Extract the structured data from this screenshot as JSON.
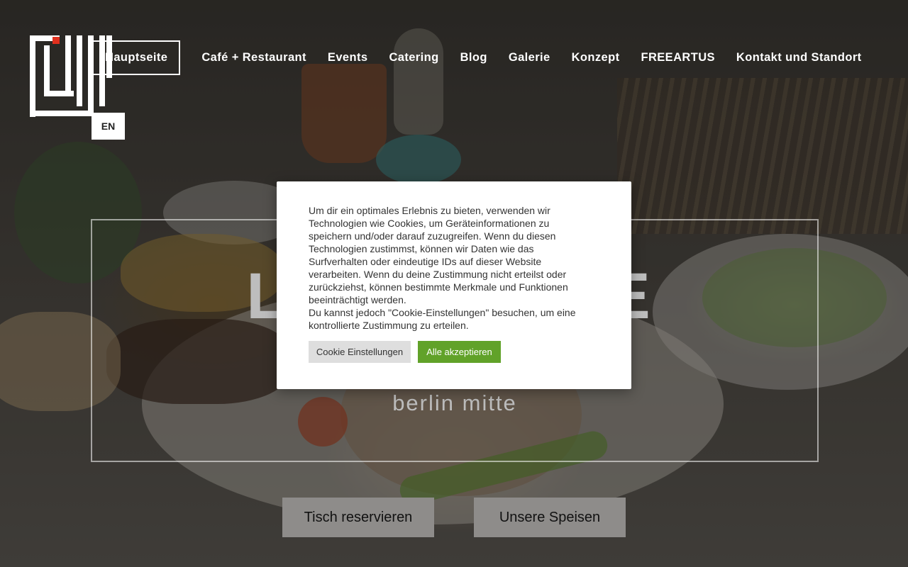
{
  "nav": {
    "items": [
      "Hauptseite",
      "Café + Restaurant",
      "Events",
      "Catering",
      "Blog",
      "Galerie",
      "Konzept",
      "FREEARTUS",
      "Kontakt und Standort"
    ]
  },
  "lang": {
    "label": "EN"
  },
  "hero": {
    "title": "L          E",
    "subtitle": "berlin mitte"
  },
  "cta": {
    "reserve": "Tisch reservieren",
    "menu": "Unsere Speisen"
  },
  "cookie": {
    "text1": "Um dir ein optimales Erlebnis zu bieten, verwenden wir Technologien wie Cookies, um Geräteinformationen zu speichern und/oder darauf zuzugreifen. Wenn du diesen Technologien zustimmst, können wir Daten wie das Surfverhalten oder eindeutige IDs auf dieser Website verarbeiten. Wenn du deine Zustimmung nicht erteilst oder zurückziehst, können bestimmte Merkmale und Funktionen beeinträchtigt werden.",
    "text2": "Du kannst jedoch \"Cookie-Einstellungen\" besuchen, um eine kontrollierte Zustimmung zu erteilen.",
    "settings_label": "Cookie Einstellungen",
    "accept_label": "Alle akzeptieren"
  },
  "colors": {
    "accept": "#61a229",
    "logo_accent": "#e0301e"
  }
}
